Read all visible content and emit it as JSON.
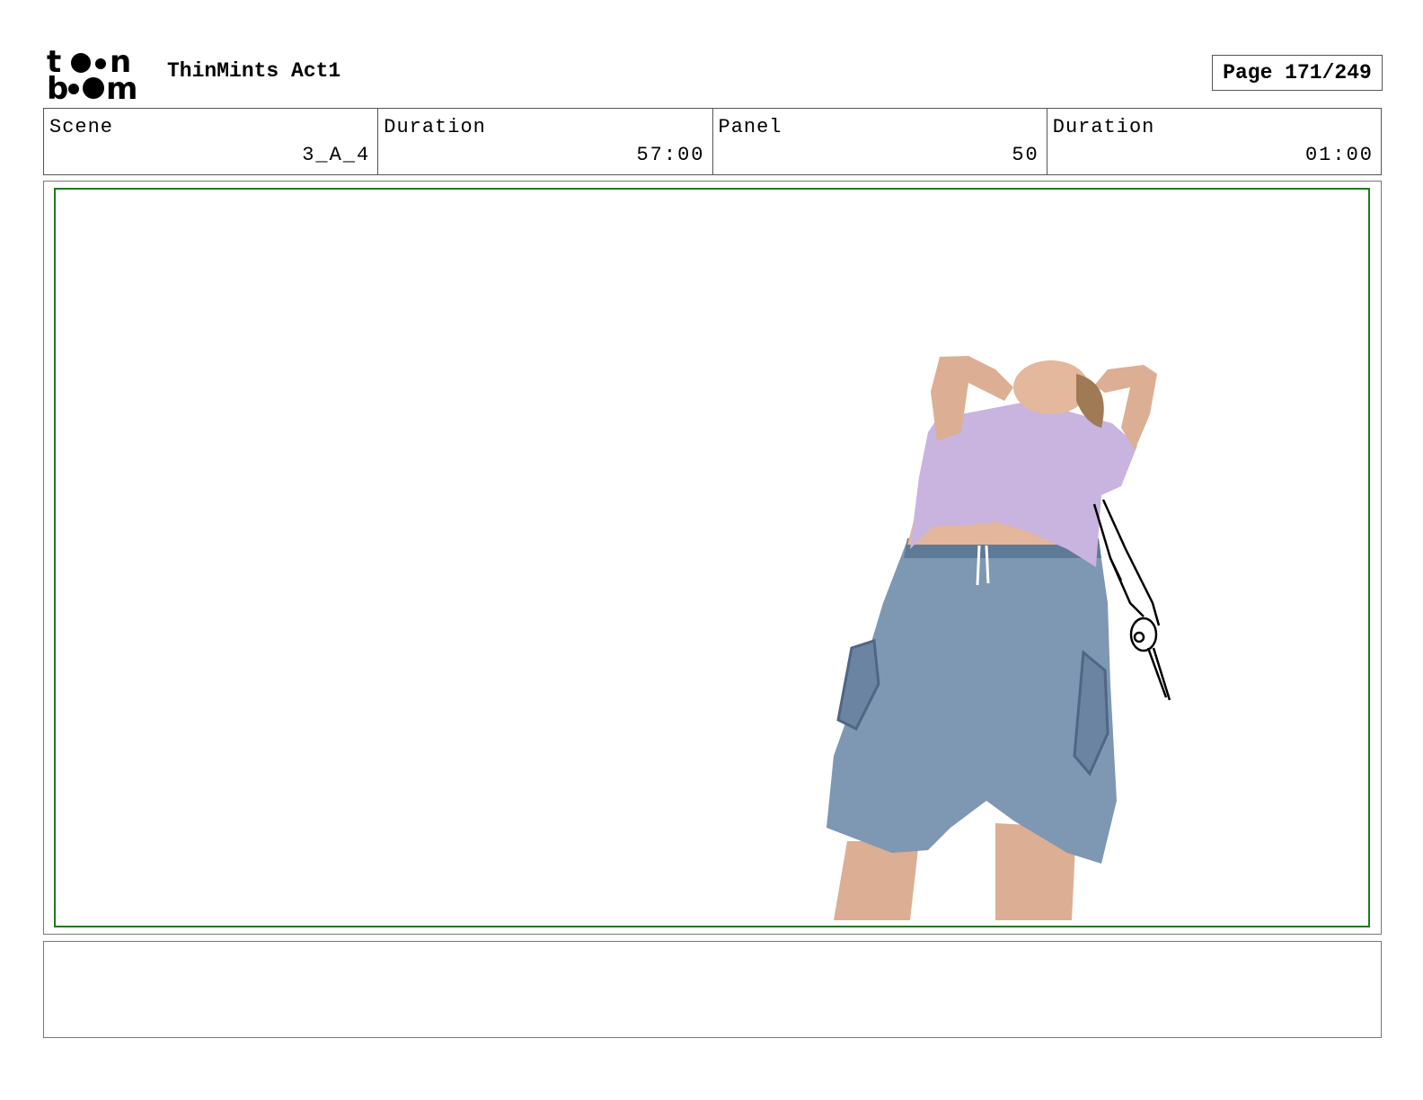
{
  "header": {
    "logo_text": "toon boom",
    "project_title": "ThinMints Act1",
    "page_label": "Page 171/249"
  },
  "info_bar": [
    {
      "label": "Scene",
      "value": "3_A_4"
    },
    {
      "label": "Duration",
      "value": "57:00"
    },
    {
      "label": "Panel",
      "value": "50"
    },
    {
      "label": "Duration",
      "value": "01:00"
    }
  ],
  "panel": {
    "image_subject": "person-looking-up-with-sketch",
    "colors": {
      "safe_area_border": "#1f7a1f",
      "shirt": "#c9b3df",
      "shorts": "#7e97b3",
      "skin": "#e0b49a",
      "hair": "#a07a55"
    }
  },
  "notes": {
    "text": ""
  }
}
